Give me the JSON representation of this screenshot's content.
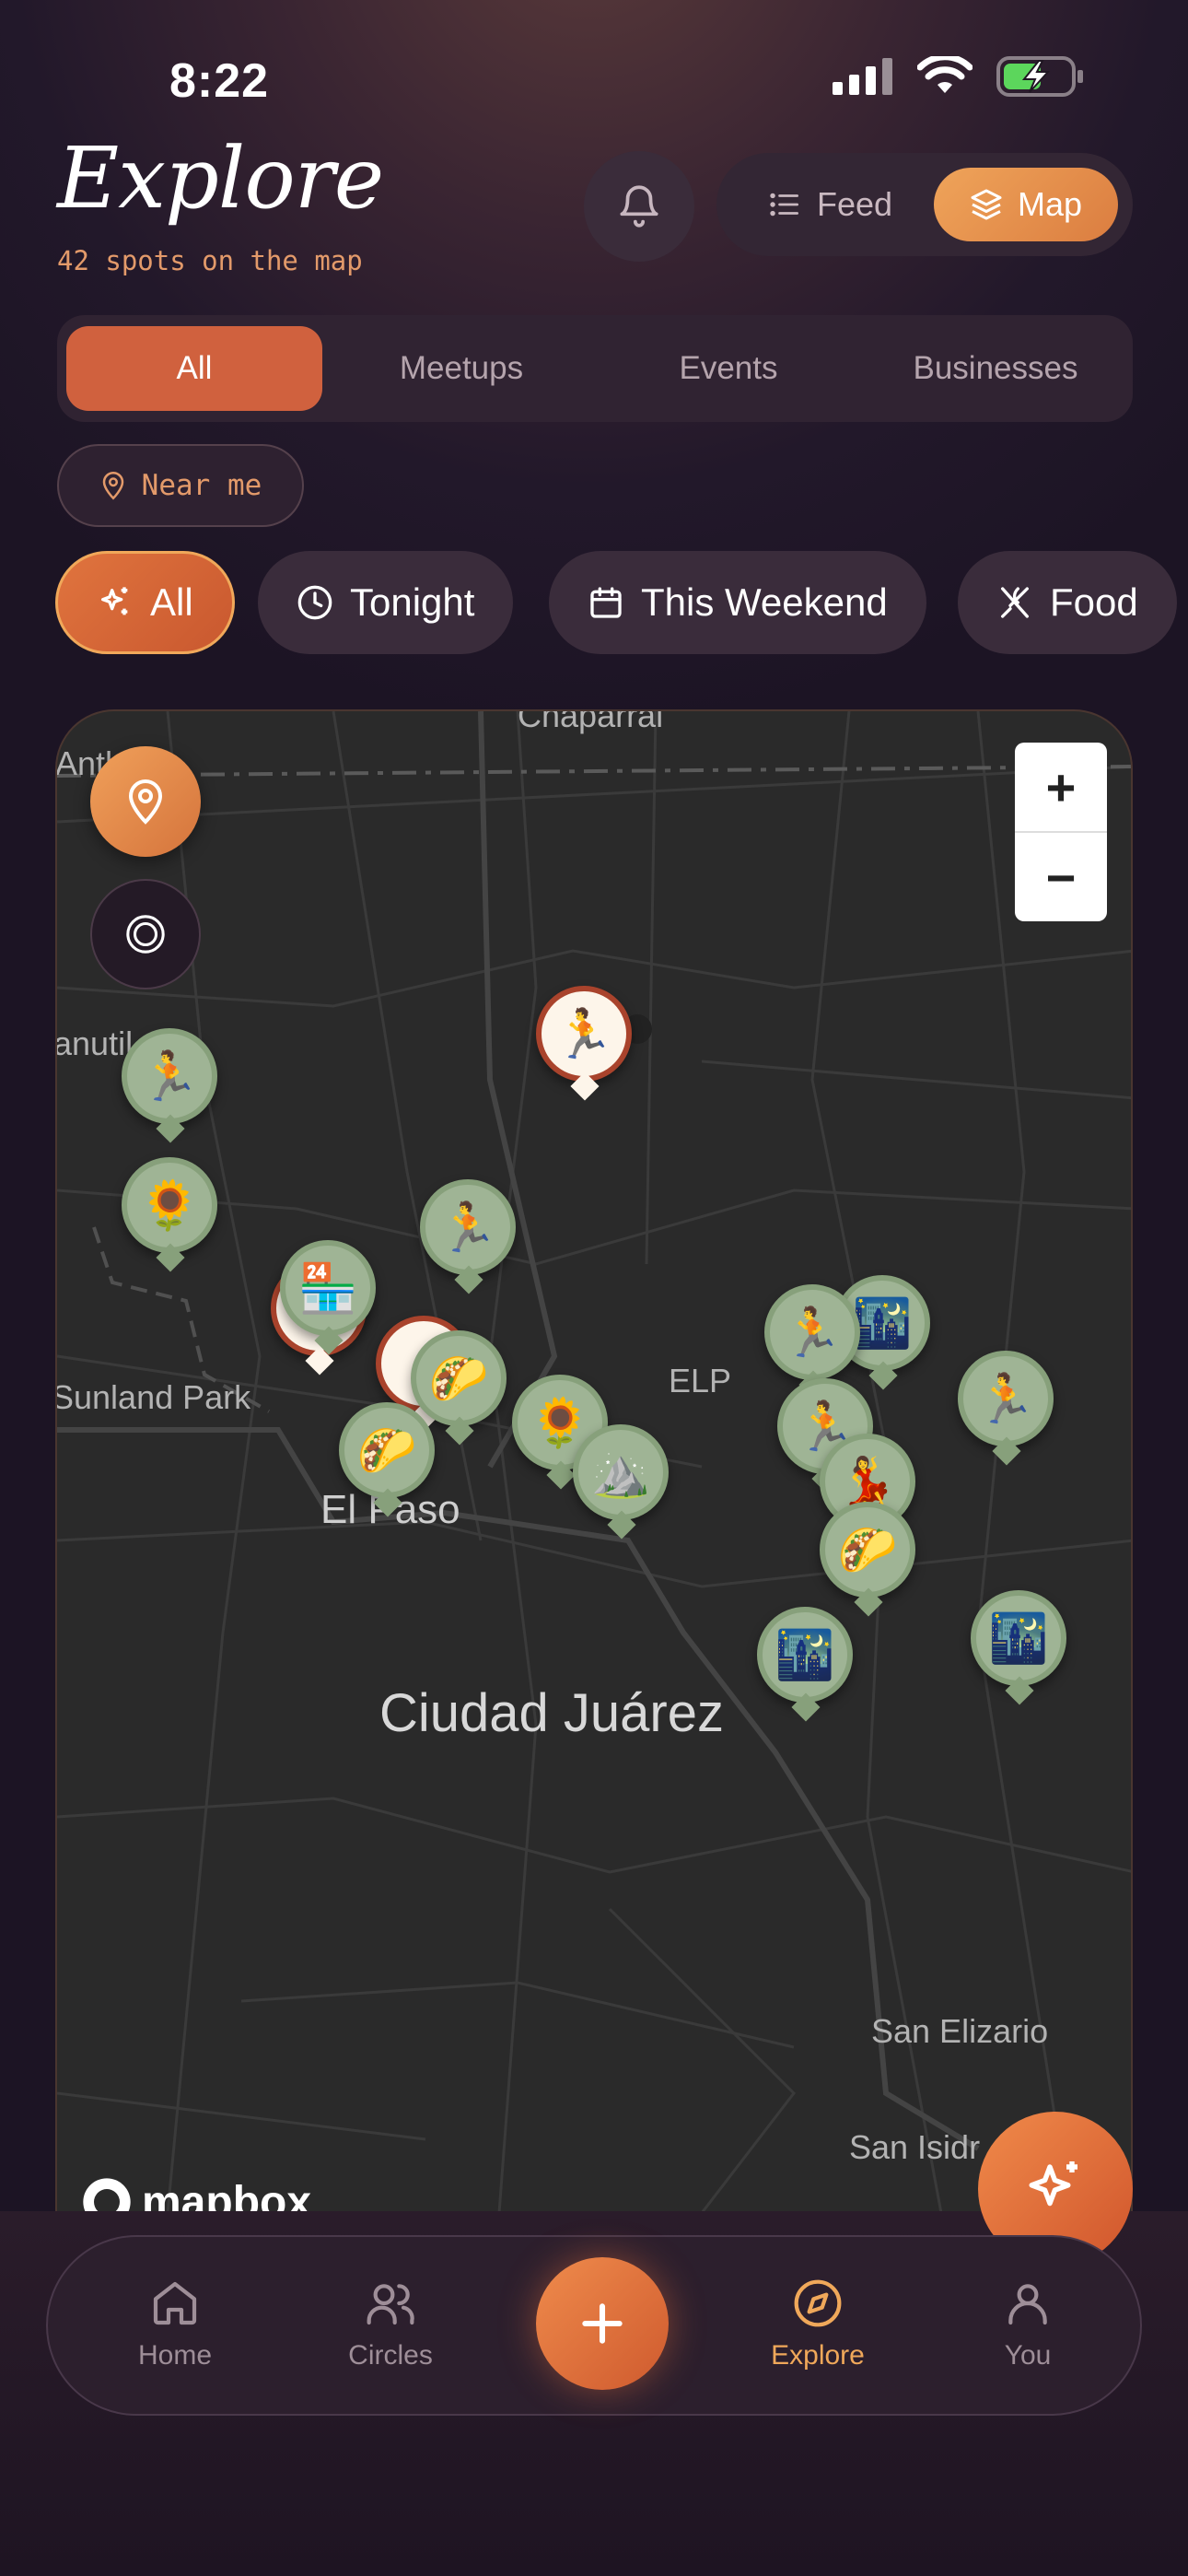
{
  "status": {
    "time": "8:22"
  },
  "header": {
    "title": "Explore",
    "subtitle": "42 spots on the map",
    "view_toggle": {
      "feed_label": "Feed",
      "map_label": "Map",
      "selected": "Map"
    }
  },
  "segments": [
    {
      "label": "All",
      "active": true
    },
    {
      "label": "Meetups",
      "active": false
    },
    {
      "label": "Events",
      "active": false
    },
    {
      "label": "Businesses",
      "active": false
    }
  ],
  "near_me": {
    "label": "Near me"
  },
  "filters": [
    {
      "label": "All",
      "icon": "sparkles-icon",
      "active": true
    },
    {
      "label": "Tonight",
      "icon": "clock-icon",
      "active": false
    },
    {
      "label": "This Weekend",
      "icon": "calendar-icon",
      "active": false
    },
    {
      "label": "Food",
      "icon": "utensils-icon",
      "active": false
    }
  ],
  "map": {
    "labels": {
      "chaparral": "Chaparral",
      "anthony": "Anth",
      "canutillo": "anutil",
      "sunland_park": "Sunland Park",
      "elp": "ELP",
      "el_paso": "El Paso",
      "ciudad_juarez": "Ciudad Juárez",
      "san_elizario": "San Elizario",
      "san_isidro": "San Isidr"
    },
    "attribution": "mapbox",
    "pins": [
      {
        "emoji": "🏃",
        "selected": true
      },
      {
        "emoji": "🏃",
        "selected": false
      },
      {
        "emoji": "🌻",
        "selected": false
      },
      {
        "emoji": "🏃",
        "selected": false
      },
      {
        "emoji": "🏪",
        "selected": false
      },
      {
        "emoji": "🌮",
        "selected": false
      },
      {
        "emoji": "🌮",
        "selected": false
      },
      {
        "emoji": "🌻",
        "selected": false
      },
      {
        "emoji": "⛰️",
        "selected": false
      },
      {
        "emoji": "🏃",
        "selected": false
      },
      {
        "emoji": "🌃",
        "selected": false
      },
      {
        "emoji": "🏃",
        "selected": false
      },
      {
        "emoji": "💃",
        "selected": false
      },
      {
        "emoji": "🌮",
        "selected": false
      },
      {
        "emoji": "🏃",
        "selected": false
      },
      {
        "emoji": "🌃",
        "selected": false
      },
      {
        "emoji": "🌃",
        "selected": false
      }
    ],
    "zoom_in": "+",
    "zoom_out": "−"
  },
  "nav": [
    {
      "label": "Home",
      "icon": "home-icon",
      "active": false
    },
    {
      "label": "Circles",
      "icon": "users-icon",
      "active": false
    },
    {
      "label": "Explore",
      "icon": "compass-icon",
      "active": true
    },
    {
      "label": "You",
      "icon": "user-icon",
      "active": false
    }
  ],
  "colors": {
    "accent": "#d0613e",
    "accent_light": "#f0a85a",
    "pin_green": "#9fb495"
  }
}
